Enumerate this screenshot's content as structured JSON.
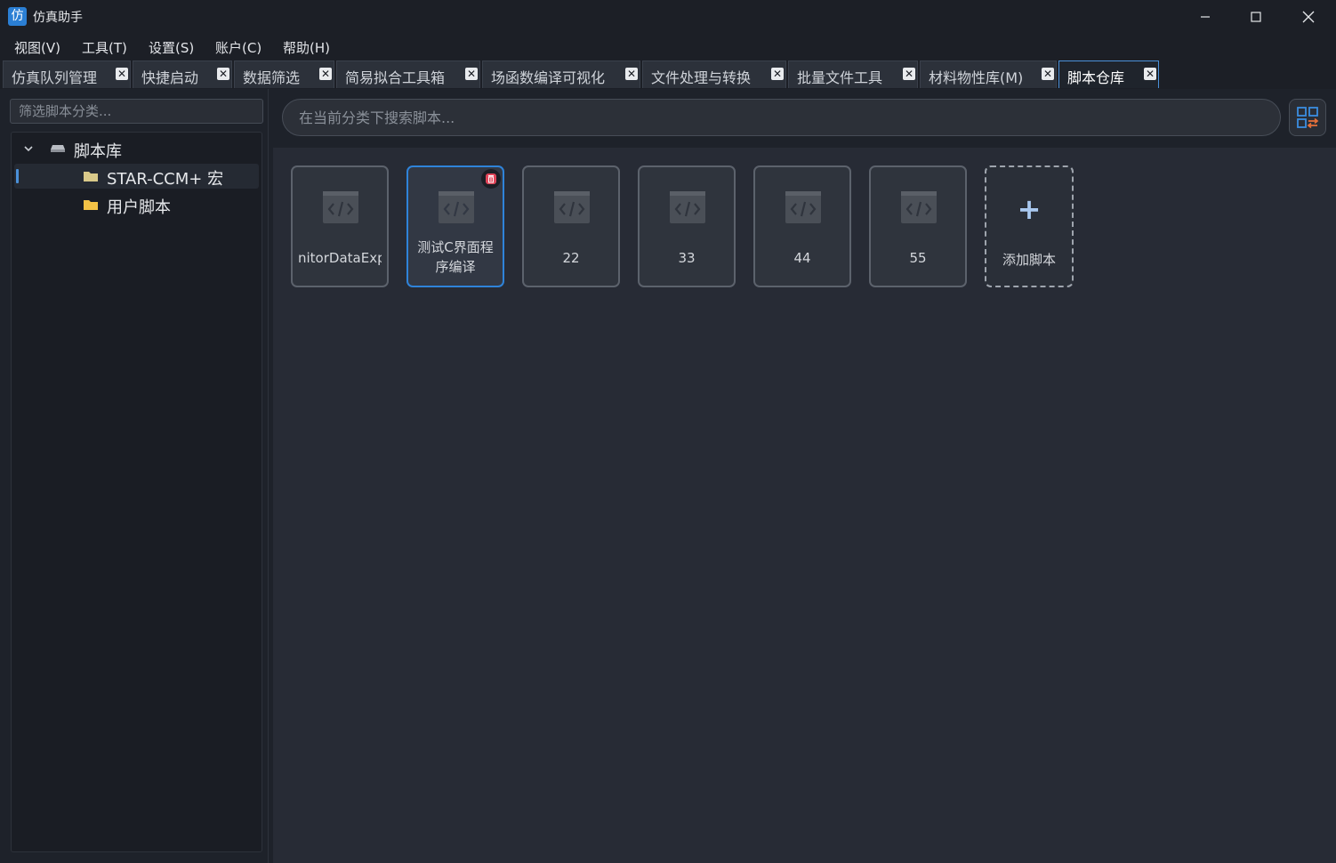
{
  "window": {
    "title": "仿真助手",
    "icon_glyph": "仿"
  },
  "menu": [
    {
      "label": "视图(V)"
    },
    {
      "label": "工具(T)"
    },
    {
      "label": "设置(S)"
    },
    {
      "label": "账户(C)"
    },
    {
      "label": "帮助(H)"
    }
  ],
  "tabs": [
    {
      "label": "仿真队列管理"
    },
    {
      "label": "快捷启动"
    },
    {
      "label": "数据筛选"
    },
    {
      "label": "简易拟合工具箱"
    },
    {
      "label": "场函数编译可视化"
    },
    {
      "label": "文件处理与转换"
    },
    {
      "label": "批量文件工具"
    },
    {
      "label": "材料物性库(M)"
    },
    {
      "label": "脚本仓库",
      "active": true
    }
  ],
  "tab_close_glyph": "✕",
  "sidebar": {
    "filter_placeholder": "筛选脚本分类...",
    "tree": {
      "root_label": "脚本库",
      "items": [
        {
          "label": "STAR-CCM+ 宏",
          "selected": true
        },
        {
          "label": "用户脚本",
          "selected": false
        }
      ]
    }
  },
  "main": {
    "search_placeholder": "在当前分类下搜索脚本...",
    "cards": [
      {
        "label": "nitorDataExpo"
      },
      {
        "label": "测试C界面程序编译",
        "selected": true
      },
      {
        "label": "22"
      },
      {
        "label": "33"
      },
      {
        "label": "44"
      },
      {
        "label": "55"
      }
    ],
    "add_card": {
      "plus": "+",
      "label": "添加脚本"
    }
  },
  "colors": {
    "accent": "#2f83d9",
    "delete": "#e0455a",
    "folder_open": "#f3c246",
    "folder_selected": "#d9c98a"
  }
}
